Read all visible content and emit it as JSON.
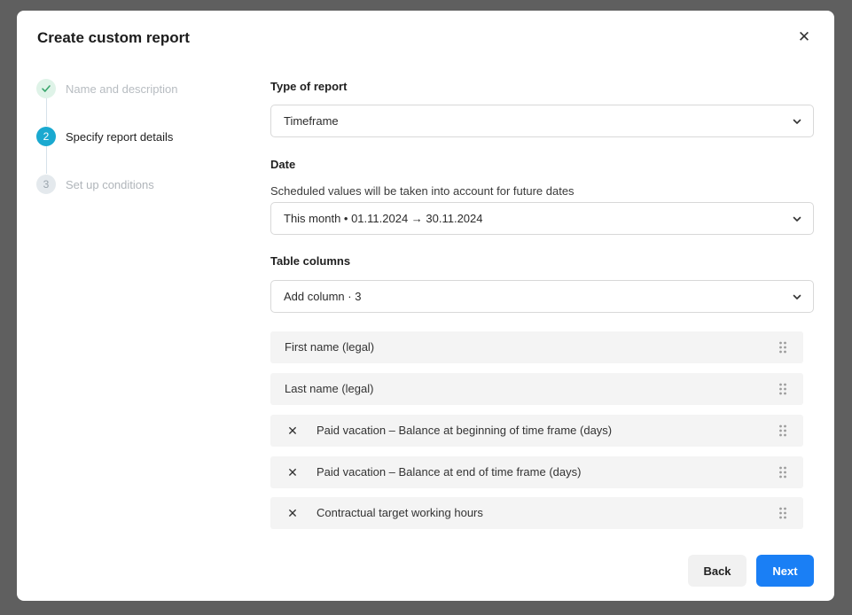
{
  "modal": {
    "title": "Create custom report",
    "close_icon": "close-icon"
  },
  "stepper": {
    "steps": [
      {
        "number": "",
        "label": "Name and description",
        "status": "done"
      },
      {
        "number": "2",
        "label": "Specify report details",
        "status": "active"
      },
      {
        "number": "3",
        "label": "Set up conditions",
        "status": "todo"
      }
    ]
  },
  "report_type": {
    "label": "Type of report",
    "value": "Timeframe"
  },
  "date": {
    "label": "Date",
    "hint": "Scheduled values will be taken into account for future dates",
    "value": "This month • 01.11.2024 → 30.11.2024"
  },
  "table_columns": {
    "label": "Table columns",
    "add_value": "Add column · 3",
    "rows": [
      {
        "label": "First name (legal)",
        "removable": false
      },
      {
        "label": "Last name (legal)",
        "removable": false
      },
      {
        "label": "Paid vacation – Balance at beginning of time frame (days)",
        "removable": true
      },
      {
        "label": "Paid vacation – Balance at end of time frame (days)",
        "removable": true
      },
      {
        "label": "Contractual target working hours",
        "removable": true
      }
    ]
  },
  "footer": {
    "back_label": "Back",
    "next_label": "Next"
  },
  "colors": {
    "accent": "#1a7ff5",
    "step_active": "#1aa9d0",
    "step_done_bg": "#dff3e8"
  }
}
